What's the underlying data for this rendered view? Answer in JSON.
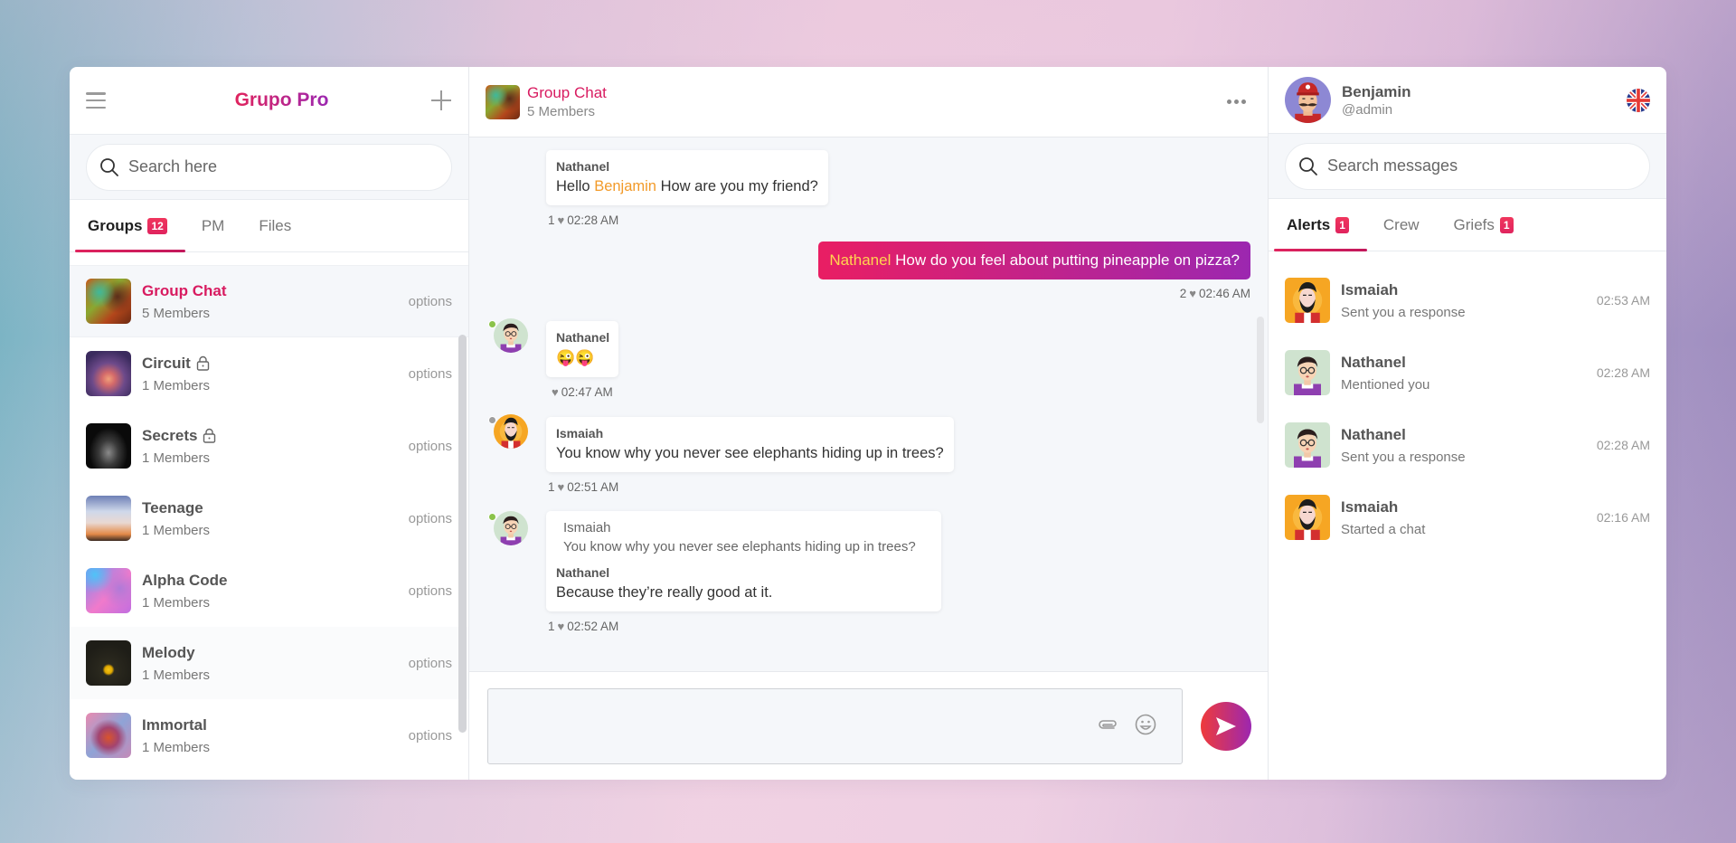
{
  "app": {
    "title": "Grupo Pro",
    "accent_gradient": [
      "#e0245e",
      "#9c27b0"
    ]
  },
  "left": {
    "search_placeholder": "Search here",
    "tabs": [
      {
        "label": "Groups",
        "badge": "12",
        "active": true
      },
      {
        "label": "PM"
      },
      {
        "label": "Files"
      }
    ],
    "groups": [
      {
        "name": "Group Chat",
        "members": "5 Members",
        "option": "options",
        "locked": false,
        "selected": true
      },
      {
        "name": "Circuit",
        "members": "1 Members",
        "option": "options",
        "locked": true
      },
      {
        "name": "Secrets",
        "members": "1 Members",
        "option": "options",
        "locked": true
      },
      {
        "name": "Teenage",
        "members": "1 Members",
        "option": "options",
        "locked": false
      },
      {
        "name": "Alpha Code",
        "members": "1 Members",
        "option": "options",
        "locked": false
      },
      {
        "name": "Melody",
        "members": "1 Members",
        "option": "options",
        "locked": false
      },
      {
        "name": "Immortal",
        "members": "1 Members",
        "option": "options",
        "locked": false
      }
    ]
  },
  "chat": {
    "title": "Group Chat",
    "subtitle": "5 Members",
    "messages": [
      {
        "author": "Nathanel",
        "text_before": "Hello ",
        "mention": "Benjamin",
        "text_after": " How are you my friend?",
        "likes": "1",
        "time": "02:28 AM"
      },
      {
        "own": true,
        "mention": "Nathanel",
        "text": " How do you feel about putting pineapple on pizza?",
        "likes": "2",
        "time": "02:46 AM"
      },
      {
        "author": "Nathanel",
        "text": "😜😜",
        "likes": "",
        "time": "02:47 AM",
        "status": "online"
      },
      {
        "author": "Ismaiah",
        "text": "You know why you never see elephants hiding up in trees?",
        "likes": "1",
        "time": "02:51 AM",
        "status": "offline"
      },
      {
        "author": "Nathanel",
        "quote_author": "Ismaiah",
        "quote_text": "You know why you never see elephants hiding up in trees?",
        "text": "Because they’re really good at it.",
        "likes": "1",
        "time": "02:52 AM",
        "status": "online"
      }
    ],
    "composer_placeholder": "",
    "status_colors": {
      "online": "#8bc34a",
      "offline": "#9e9e9e"
    }
  },
  "right": {
    "user": {
      "name": "Benjamin",
      "handle": "@admin"
    },
    "search_placeholder": "Search messages",
    "tabs": [
      {
        "label": "Alerts",
        "badge": "1",
        "active": true
      },
      {
        "label": "Crew"
      },
      {
        "label": "Griefs",
        "badge": "1"
      }
    ],
    "alerts": [
      {
        "name": "Ismaiah",
        "text": "Sent you a response",
        "time": "02:53 AM"
      },
      {
        "name": "Nathanel",
        "text": "Mentioned you",
        "time": "02:28 AM"
      },
      {
        "name": "Nathanel",
        "text": "Sent you a response",
        "time": "02:28 AM"
      },
      {
        "name": "Ismaiah",
        "text": "Started a chat",
        "time": "02:16 AM"
      }
    ]
  }
}
